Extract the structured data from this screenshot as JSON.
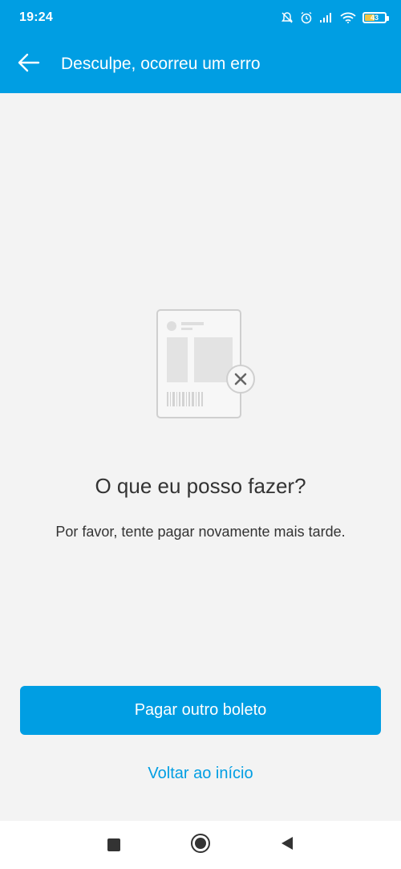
{
  "statusbar": {
    "time": "19:24",
    "battery": "43"
  },
  "appbar": {
    "title": "Desculpe, ocorreu um erro"
  },
  "main": {
    "heading": "O que eu posso fazer?",
    "message": "Por favor, tente pagar novamente mais tarde."
  },
  "actions": {
    "primary_label": "Pagar outro boleto",
    "secondary_label": "Voltar ao início"
  },
  "colors": {
    "brand": "#009ee3",
    "background": "#f3f3f3",
    "text": "#333333"
  },
  "icons": {
    "back": "arrow-left-icon",
    "illustration": "boleto-error-icon",
    "close": "close-icon",
    "nav_recents": "square-icon",
    "nav_home": "circle-icon",
    "nav_back": "triangle-left-icon"
  }
}
